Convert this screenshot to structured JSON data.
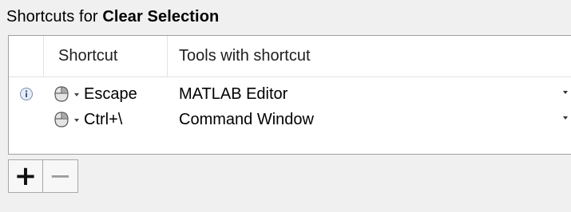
{
  "title": {
    "prefix": "Shortcuts for ",
    "command": "Clear Selection"
  },
  "table": {
    "columns": [
      "Shortcut",
      "Tools with shortcut"
    ],
    "rows": [
      {
        "has_info": true,
        "shortcut": "Escape",
        "tool": "MATLAB Editor"
      },
      {
        "has_info": false,
        "shortcut": "Ctrl+\\",
        "tool": "Command Window"
      }
    ]
  },
  "buttons": {
    "add": "+",
    "remove": "−"
  },
  "icons": {
    "info": "info-icon",
    "mouse": "mouse-icon"
  }
}
